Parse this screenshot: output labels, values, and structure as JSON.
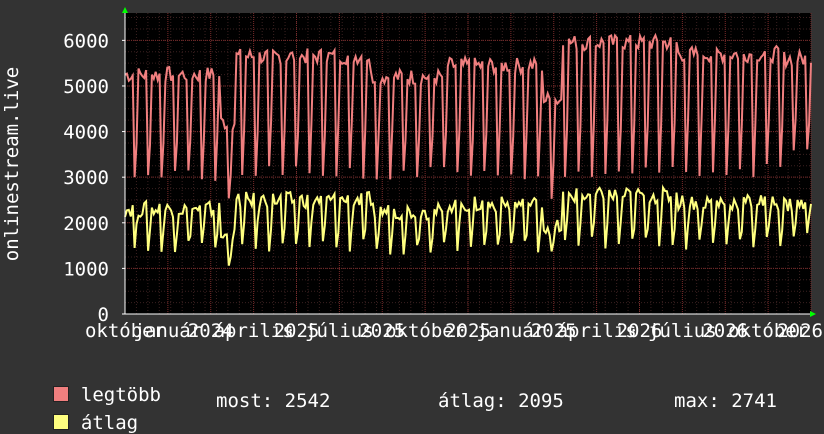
{
  "chart_data": {
    "type": "line",
    "ylabel": "onlinestream.live",
    "ylim": [
      0,
      6600
    ],
    "yticks": [
      0,
      1000,
      2000,
      3000,
      4000,
      5000,
      6000
    ],
    "xticks": [
      "október",
      "január",
      "2024",
      "április",
      "2025",
      "július",
      "2025",
      "október",
      "2025",
      "január",
      "2025",
      "április",
      "2026",
      "július",
      "2026",
      "október",
      "2026"
    ],
    "grid": true,
    "colors": {
      "background": "#000000",
      "page": "#333333",
      "grid_minor": "#3a2020",
      "grid_major": "#7a2a2a",
      "axis": "#ffffff",
      "arrow": "#00ff00"
    },
    "series": [
      {
        "name": "legtöbb",
        "color": "#f07f7f",
        "segments": [
          {
            "count": 50,
            "base": 5250,
            "dip": 2850
          },
          {
            "count": 8,
            "base": 4200,
            "dip": 2400
          },
          {
            "count": 70,
            "base": 5650,
            "dip": 2950
          },
          {
            "count": 40,
            "base": 5200,
            "dip": 2950
          },
          {
            "count": 50,
            "base": 5450,
            "dip": 2900
          },
          {
            "count": 10,
            "base": 4700,
            "dip": 2500
          },
          {
            "count": 60,
            "base": 5950,
            "dip": 3000
          },
          {
            "count": 55,
            "base": 5700,
            "dip": 3000
          },
          {
            "count": 15,
            "base": 5600,
            "dip": 3400
          }
        ]
      },
      {
        "name": "átlag",
        "color": "#ffff80",
        "segments": [
          {
            "count": 50,
            "base": 2300,
            "dip": 1350
          },
          {
            "count": 8,
            "base": 1700,
            "dip": 1000
          },
          {
            "count": 70,
            "base": 2500,
            "dip": 1350
          },
          {
            "count": 40,
            "base": 2250,
            "dip": 1300
          },
          {
            "count": 50,
            "base": 2400,
            "dip": 1350
          },
          {
            "count": 10,
            "base": 1900,
            "dip": 1100
          },
          {
            "count": 60,
            "base": 2600,
            "dip": 1400
          },
          {
            "count": 55,
            "base": 2450,
            "dip": 1400
          },
          {
            "count": 15,
            "base": 2400,
            "dip": 1600
          }
        ]
      }
    ]
  },
  "legend": {
    "max_label": "legtöbb",
    "avg_label": "átlag",
    "now_text": "most: 2542",
    "avg_text": "átlag: 2095",
    "max_text": "max: 2741"
  }
}
